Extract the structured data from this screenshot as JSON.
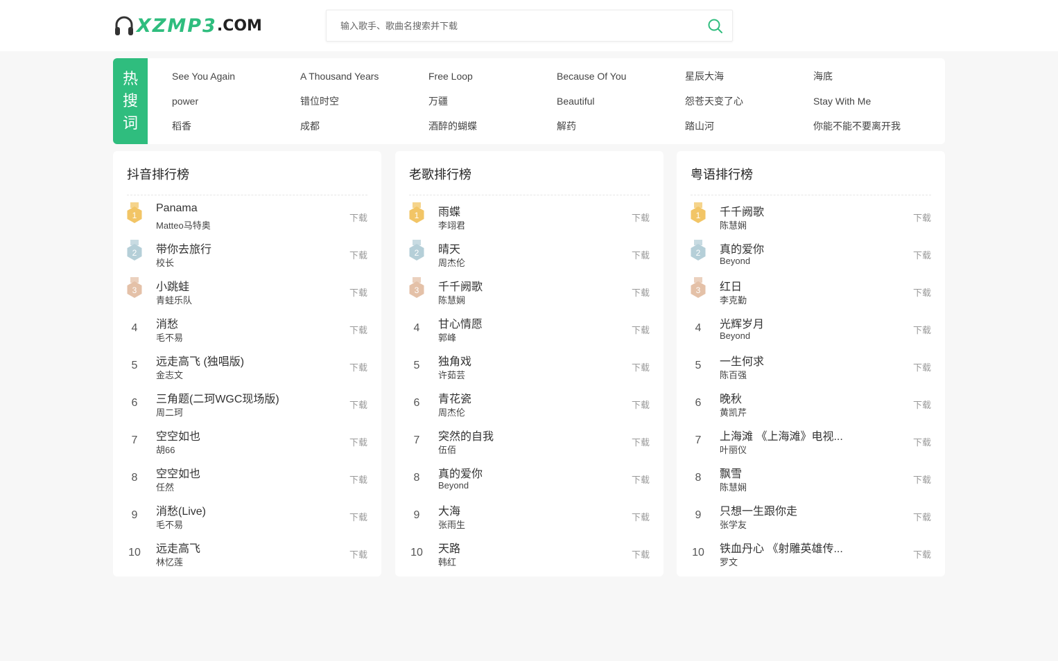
{
  "brand": {
    "name": "XZMP3",
    "domain": ".COM"
  },
  "search": {
    "placeholder": "输入歌手、歌曲名搜索并下载"
  },
  "hot": {
    "tag_chars": [
      "热",
      "搜",
      "词"
    ],
    "items": [
      "See You Again",
      "A Thousand Years",
      "Free Loop",
      "Because Of You",
      "星辰大海",
      "海底",
      "power",
      "错位时空",
      "万疆",
      "Beautiful",
      "怨苍天变了心",
      "Stay With Me",
      "稻香",
      "成都",
      "酒醉的蝴蝶",
      "解药",
      "踏山河",
      "你能不能不要离开我"
    ]
  },
  "download_label": "下载",
  "medal_colors": [
    "#f2c566",
    "#b5cfd8",
    "#e4c1a8"
  ],
  "charts": [
    {
      "title": "抖音排行榜",
      "songs": [
        {
          "rank": "1",
          "name": "Panama",
          "singer": "Matteo马特奥"
        },
        {
          "rank": "2",
          "name": "带你去旅行",
          "singer": "校长"
        },
        {
          "rank": "3",
          "name": "小跳蛙",
          "singer": "青蛙乐队"
        },
        {
          "rank": "4",
          "name": "消愁",
          "singer": "毛不易"
        },
        {
          "rank": "5",
          "name": "远走高飞 (独唱版)",
          "singer": "金志文"
        },
        {
          "rank": "6",
          "name": "三角题(二珂WGC现场版)",
          "singer": "周二珂"
        },
        {
          "rank": "7",
          "name": "空空如也",
          "singer": "胡66"
        },
        {
          "rank": "8",
          "name": "空空如也",
          "singer": "任然"
        },
        {
          "rank": "9",
          "name": "消愁(Live)",
          "singer": "毛不易"
        },
        {
          "rank": "10",
          "name": "远走高飞",
          "singer": "林忆莲"
        }
      ]
    },
    {
      "title": "老歌排行榜",
      "songs": [
        {
          "rank": "1",
          "name": "雨蝶",
          "singer": "李翊君"
        },
        {
          "rank": "2",
          "name": "晴天",
          "singer": "周杰伦"
        },
        {
          "rank": "3",
          "name": "千千阙歌",
          "singer": "陈慧娴"
        },
        {
          "rank": "4",
          "name": "甘心情愿",
          "singer": "郭峰"
        },
        {
          "rank": "5",
          "name": "独角戏",
          "singer": "许茹芸"
        },
        {
          "rank": "6",
          "name": "青花瓷",
          "singer": "周杰伦"
        },
        {
          "rank": "7",
          "name": "突然的自我",
          "singer": "伍佰"
        },
        {
          "rank": "8",
          "name": "真的爱你",
          "singer": "Beyond"
        },
        {
          "rank": "9",
          "name": "大海",
          "singer": "张雨生"
        },
        {
          "rank": "10",
          "name": "天路",
          "singer": "韩红"
        }
      ]
    },
    {
      "title": "粤语排行榜",
      "songs": [
        {
          "rank": "1",
          "name": "千千阙歌",
          "singer": "陈慧娴"
        },
        {
          "rank": "2",
          "name": "真的爱你",
          "singer": "Beyond"
        },
        {
          "rank": "3",
          "name": "红日",
          "singer": "李克勤"
        },
        {
          "rank": "4",
          "name": "光辉岁月",
          "singer": "Beyond"
        },
        {
          "rank": "5",
          "name": "一生何求",
          "singer": "陈百强"
        },
        {
          "rank": "6",
          "name": "晚秋",
          "singer": "黄凯芹"
        },
        {
          "rank": "7",
          "name": "上海滩 《上海滩》电视...",
          "singer": "叶丽仪"
        },
        {
          "rank": "8",
          "name": "飘雪",
          "singer": "陈慧娴"
        },
        {
          "rank": "9",
          "name": "只想一生跟你走",
          "singer": "张学友"
        },
        {
          "rank": "10",
          "name": "铁血丹心 《射雕英雄传...",
          "singer": "罗文"
        }
      ]
    }
  ]
}
